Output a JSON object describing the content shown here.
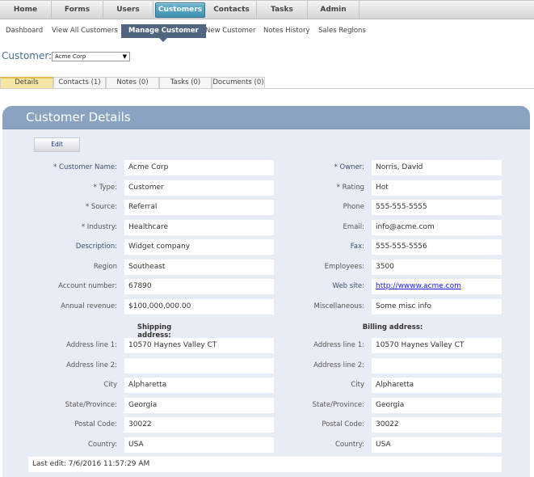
{
  "topnav": {
    "tabs": [
      {
        "label": "Home",
        "active": false
      },
      {
        "label": "Forms",
        "active": false
      },
      {
        "label": "Users",
        "active": false
      },
      {
        "label": "Customers",
        "active": true
      },
      {
        "label": "Contacts",
        "active": false
      },
      {
        "label": "Tasks",
        "active": false
      },
      {
        "label": "Admin",
        "active": false
      }
    ]
  },
  "subnav": {
    "items": [
      {
        "label": "Dashboard",
        "active": false
      },
      {
        "label": "View All Customers",
        "active": false
      },
      {
        "label": "Manage Customer",
        "active": true
      },
      {
        "label": "New Customer",
        "active": false
      },
      {
        "label": "Notes History",
        "active": false
      },
      {
        "label": "Sales Regions",
        "active": false
      }
    ]
  },
  "customer_selector": {
    "label": "Customer:",
    "selected": "Acme Corp",
    "arrow": "▼"
  },
  "subtabs": [
    {
      "label": "Details",
      "active": true
    },
    {
      "label": "Contacts (1)",
      "active": false
    },
    {
      "label": "Notes (0)",
      "active": false
    },
    {
      "label": "Tasks (0)",
      "active": false
    },
    {
      "label": "Documents (0)",
      "active": false
    }
  ],
  "panel": {
    "title": "Customer Details",
    "edit_label": "Edit",
    "left_fields": [
      {
        "label": "* Customer Name:",
        "value": "Acme Corp"
      },
      {
        "label": "* Type:",
        "value": "Customer"
      },
      {
        "label": "* Source:",
        "value": "Referral"
      },
      {
        "label": "* Industry:",
        "value": "Healthcare"
      },
      {
        "label": "Description:",
        "value": "Widget company"
      },
      {
        "label": "Region",
        "value": "Southeast"
      },
      {
        "label": "Account number:",
        "value": "67890"
      },
      {
        "label": "Annual revenue:",
        "value": "$100,000,000.00"
      }
    ],
    "right_fields": [
      {
        "label": "* Owner:",
        "value": "Norris, David"
      },
      {
        "label": "* Rating",
        "value": "Hot"
      },
      {
        "label": "Phone",
        "value": "555-555-5555"
      },
      {
        "label": "Email:",
        "value": "info@acme.com"
      },
      {
        "label": "Fax:",
        "value": "555-555-5556"
      },
      {
        "label": "Employees:",
        "value": "3500"
      },
      {
        "label": "Web site:",
        "value": "http://wwww.acme.com"
      },
      {
        "label": "Miscellaneous:",
        "value": "Some misc info"
      }
    ],
    "shipping": {
      "heading": "Shipping address:",
      "fields": [
        {
          "label": "Address line 1:",
          "value": "10570 Haynes Valley CT"
        },
        {
          "label": "Address line 2:",
          "value": ""
        },
        {
          "label": "City",
          "value": "Alpharetta"
        },
        {
          "label": "State/Province:",
          "value": "Georgia"
        },
        {
          "label": "Postal Code:",
          "value": "30022"
        },
        {
          "label": "Country:",
          "value": "USA"
        }
      ]
    },
    "billing": {
      "heading": "Billing address:",
      "fields": [
        {
          "label": "Address line 1:",
          "value": "10570 Haynes Valley CT"
        },
        {
          "label": "Address line 2:",
          "value": ""
        },
        {
          "label": "City",
          "value": "Alpharetta"
        },
        {
          "label": "State/Province:",
          "value": "Georgia"
        },
        {
          "label": "Postal Code:",
          "value": "30022"
        },
        {
          "label": "Country:",
          "value": "USA"
        }
      ]
    },
    "last_edit": "Last edit: 7/6/2016 11:57:29 AM"
  },
  "colors": {
    "accent_tab": "#4a9dbf",
    "subnav_active": "#4f6580",
    "panel_header": "#8aa3c0",
    "panel_bg": "#e8ecf4",
    "subtab_active": "#f5e6a5",
    "link": "#1a1aee"
  }
}
